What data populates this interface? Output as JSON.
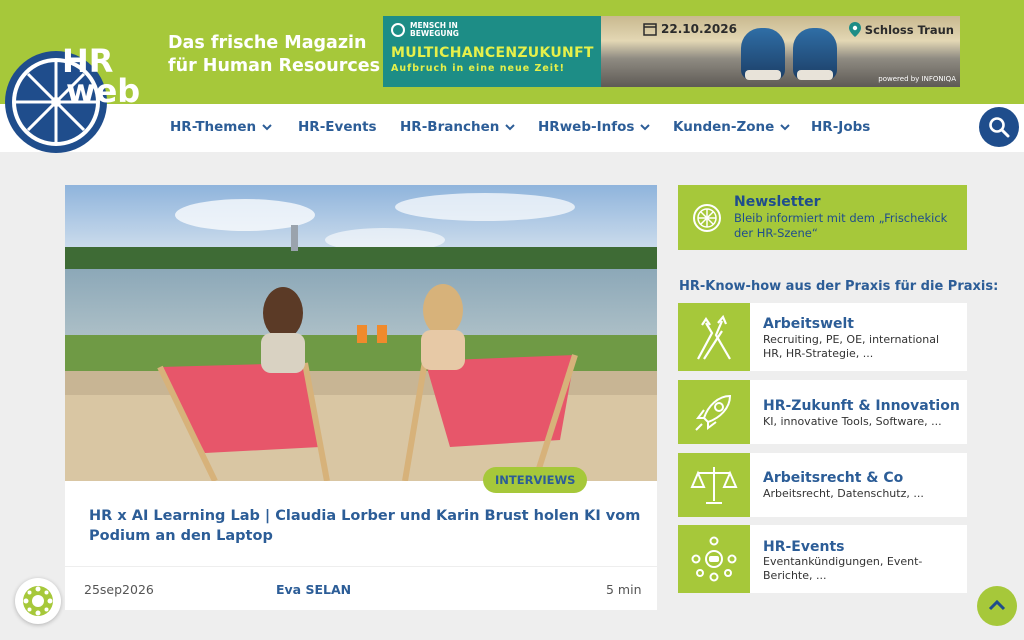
{
  "header": {
    "logo_text_1": "HR",
    "logo_text_2": "web",
    "tagline_line1": "Das frische Magazin",
    "tagline_line2": "für Human Resources"
  },
  "banner": {
    "event_line1": "MENSCH IN",
    "event_line2": "BEWEGUNG",
    "headline": "MULTICHANCENZUKUNFT",
    "subline": "Aufbruch in eine neue Zeit!",
    "date": "22.10.2026",
    "location": "Schloss Traun",
    "powered_by": "powered by INFONIQA"
  },
  "nav": {
    "items": [
      {
        "label": "HR-Themen",
        "dropdown": true
      },
      {
        "label": "HR-Events",
        "dropdown": false
      },
      {
        "label": "HR-Branchen",
        "dropdown": true
      },
      {
        "label": "HRweb-Infos",
        "dropdown": true
      },
      {
        "label": "Kunden-Zone",
        "dropdown": true
      },
      {
        "label": "HR-Jobs",
        "dropdown": false
      }
    ],
    "search_icon": "search-icon"
  },
  "article": {
    "category": "INTERVIEWS",
    "title": "HR x AI Learning Lab | Claudia Lorber und Karin Brust holen KI vom Podium an den Laptop",
    "date": "25sep2026",
    "author": "Eva SELAN",
    "read_time": "5 min"
  },
  "newsletter": {
    "title": "Newsletter",
    "text": "Bleib informiert mit dem „Frischekick der HR-Szene“",
    "icon": "lemon-icon"
  },
  "sidebar": {
    "heading": "HR-Know-how aus der Praxis für die Praxis:",
    "topics": [
      {
        "title": "Arbeitswelt",
        "desc": "Recruiting, PE, OE, international HR, HR-Strategie, ...",
        "icon": "arrows-icon"
      },
      {
        "title": "HR-Zukunft & Innovation",
        "desc": "KI, innovative Tools, Software, ...",
        "icon": "rocket-icon"
      },
      {
        "title": "Arbeitsrecht & Co",
        "desc": "Arbeitsrecht, Datenschutz, ...",
        "icon": "scales-icon"
      },
      {
        "title": "HR-Events",
        "desc": "Eventankündigungen, Event-Berichte, ...",
        "icon": "people-network-icon"
      }
    ]
  },
  "colors": {
    "brand_green": "#a6c83a",
    "brand_blue": "#1f4d8c",
    "text_blue": "#2c5d97"
  }
}
